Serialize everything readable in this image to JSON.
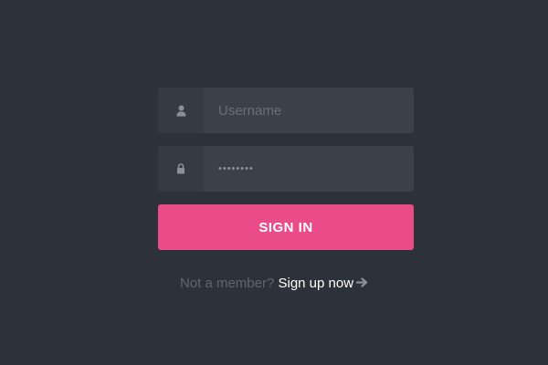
{
  "form": {
    "username": {
      "icon": "user-icon",
      "placeholder": "Username",
      "value": ""
    },
    "password": {
      "icon": "lock-icon",
      "value": "••••••••"
    },
    "signin_label": "SIGN IN"
  },
  "signup": {
    "prompt": "Not a member?",
    "link_label": "Sign up now",
    "icon": "arrow-right-icon"
  },
  "colors": {
    "background": "#2d3139",
    "field_background": "#3b4049",
    "icon_box_background": "#363b43",
    "accent": "#ea4c89",
    "muted_text": "#60666f",
    "link_text": "#ffffff"
  }
}
